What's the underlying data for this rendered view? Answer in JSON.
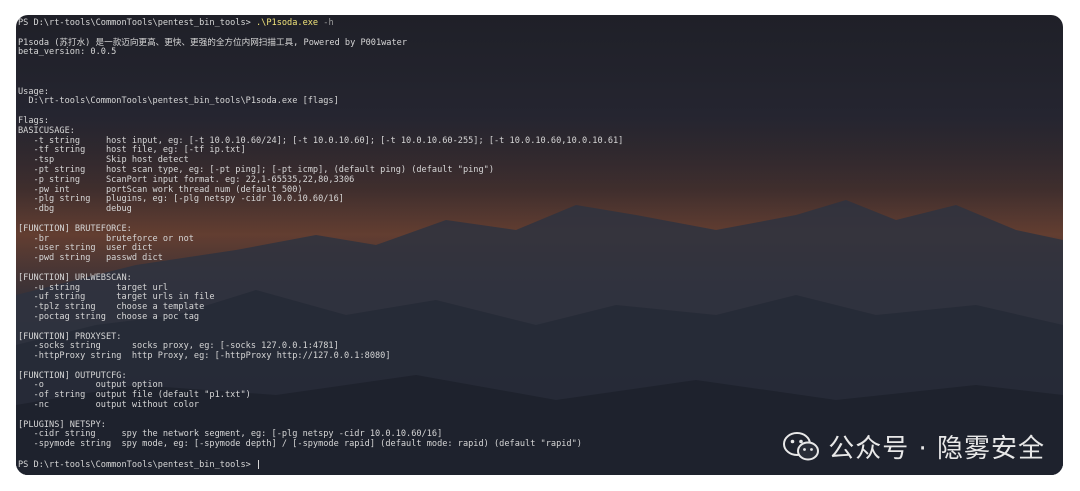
{
  "terminal": {
    "lines": [
      {
        "kind": "prompt",
        "prefix": "PS D:\\rt-tools\\CommonTools\\pentest_bin_tools> ",
        "cmd": ".\\P1soda.exe",
        "arg": " -h"
      },
      {
        "kind": "text",
        "text": ""
      },
      {
        "kind": "text",
        "text": "P1soda (苏打水) 是一款迈向更高、更快、更强的全方位内网扫描工具, Powered by P001water"
      },
      {
        "kind": "text",
        "text": "beta_version: 0.0.5"
      },
      {
        "kind": "text",
        "text": ""
      },
      {
        "kind": "text",
        "text": ""
      },
      {
        "kind": "text",
        "text": ""
      },
      {
        "kind": "text",
        "text": "Usage:"
      },
      {
        "kind": "text",
        "text": "  D:\\rt-tools\\CommonTools\\pentest_bin_tools\\P1soda.exe [flags]"
      },
      {
        "kind": "text",
        "text": ""
      },
      {
        "kind": "text",
        "text": "Flags:"
      },
      {
        "kind": "text",
        "text": "BASICUSAGE:"
      },
      {
        "kind": "text",
        "text": "   -t string     host input, eg: [-t 10.0.10.60/24]; [-t 10.0.10.60]; [-t 10.0.10.60-255]; [-t 10.0.10.60,10.0.10.61]"
      },
      {
        "kind": "text",
        "text": "   -tf string    host file, eg: [-tf ip.txt]"
      },
      {
        "kind": "text",
        "text": "   -tsp          Skip host detect"
      },
      {
        "kind": "text",
        "text": "   -pt string    host scan type, eg: [-pt ping]; [-pt icmp], (default ping) (default \"ping\")"
      },
      {
        "kind": "text",
        "text": "   -p string     ScanPort input format. eg: 22,1-65535,22,80,3306"
      },
      {
        "kind": "text",
        "text": "   -pw int       portScan work thread num (default 500)"
      },
      {
        "kind": "text",
        "text": "   -plg string   plugins, eg: [-plg netspy -cidr 10.0.10.60/16]"
      },
      {
        "kind": "text",
        "text": "   -dbg          debug"
      },
      {
        "kind": "text",
        "text": ""
      },
      {
        "kind": "text",
        "text": "[FUNCTION] BRUTEFORCE:"
      },
      {
        "kind": "text",
        "text": "   -br           bruteforce or not"
      },
      {
        "kind": "text",
        "text": "   -user string  user dict"
      },
      {
        "kind": "text",
        "text": "   -pwd string   passwd dict"
      },
      {
        "kind": "text",
        "text": ""
      },
      {
        "kind": "text",
        "text": "[FUNCTION] URLWEBSCAN:"
      },
      {
        "kind": "text",
        "text": "   -u string       target url"
      },
      {
        "kind": "text",
        "text": "   -uf string      target urls in file"
      },
      {
        "kind": "text",
        "text": "   -tplz string    choose a template"
      },
      {
        "kind": "text",
        "text": "   -poctag string  choose a poc tag"
      },
      {
        "kind": "text",
        "text": ""
      },
      {
        "kind": "text",
        "text": "[FUNCTION] PROXYSET:"
      },
      {
        "kind": "text",
        "text": "   -socks string      socks proxy, eg: [-socks 127.0.0.1:4781]"
      },
      {
        "kind": "text",
        "text": "   -httpProxy string  http Proxy, eg: [-httpProxy http://127.0.0.1:8080]"
      },
      {
        "kind": "text",
        "text": ""
      },
      {
        "kind": "text",
        "text": "[FUNCTION] OUTPUTCFG:"
      },
      {
        "kind": "text",
        "text": "   -o          output option"
      },
      {
        "kind": "text",
        "text": "   -of string  output file (default \"p1.txt\")"
      },
      {
        "kind": "text",
        "text": "   -nc         output without color"
      },
      {
        "kind": "text",
        "text": ""
      },
      {
        "kind": "text",
        "text": "[PLUGINS] NETSPY:"
      },
      {
        "kind": "text",
        "text": "   -cidr string     spy the network segment, eg: [-plg netspy -cidr 10.0.10.60/16]"
      },
      {
        "kind": "text",
        "text": "   -spymode string  spy mode, eg: [-spymode depth] / [-spymode rapid] (default mode: rapid) (default \"rapid\")"
      },
      {
        "kind": "text",
        "text": ""
      },
      {
        "kind": "prompt_cursor",
        "prefix": "PS D:\\rt-tools\\CommonTools\\pentest_bin_tools> "
      }
    ]
  },
  "watermark": {
    "text": "公众号 · 隐雾安全",
    "icon": "wechat-icon"
  }
}
